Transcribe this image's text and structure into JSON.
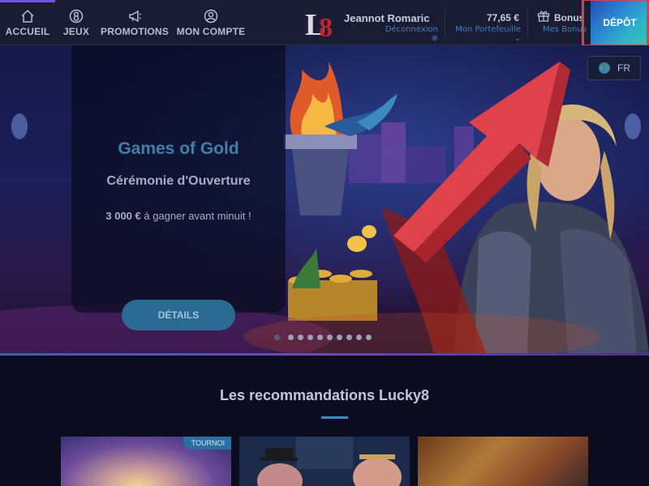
{
  "nav": {
    "items": [
      {
        "label": "ACCUEIL",
        "icon": "home-icon"
      },
      {
        "label": "JEUX",
        "icon": "lucky8-icon"
      },
      {
        "label": "PROMOTIONS",
        "icon": "megaphone-icon"
      },
      {
        "label": "MON COMPTE",
        "icon": "user-icon"
      }
    ]
  },
  "header": {
    "logo_text": "L8",
    "user_name": "Jeannot Romaric",
    "logout_label": "Déconnexion ⊗",
    "wallet_amount": "77,65 €",
    "wallet_label": "Mon Portefeuille ⌄",
    "bonus_label": "Bonus",
    "bonus_sub": "Mes Bonus",
    "deposit_label": "DÉPÔT"
  },
  "language": {
    "code": "FR",
    "icon": "globe-icon"
  },
  "hero": {
    "title": "Games of Gold",
    "subtitle": "Cérémonie d'Ouverture",
    "amount": "3 000 €",
    "text_rest": " à gagner avant minuit !",
    "details_label": "DÉTAILS",
    "slide_count": 10,
    "active_slide": 1
  },
  "recommendations": {
    "title": "Les recommandations Lucky8",
    "tiles": [
      {
        "badge": "TOURNOI"
      },
      {
        "badge": ""
      },
      {
        "badge": ""
      }
    ]
  },
  "colors": {
    "accent": "#3a8cc0",
    "nav_bg": "#1a1c33",
    "deposit_gradient_start": "#2a4ab0",
    "deposit_gradient_end": "#3ac2b6",
    "highlight_arrow": "#e0424c"
  }
}
